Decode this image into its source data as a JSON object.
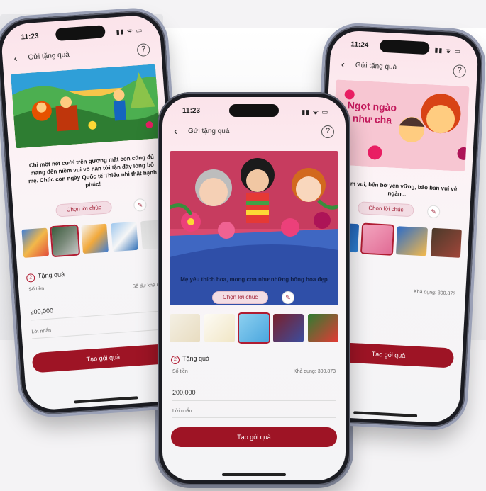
{
  "left_phone": {
    "time": "11:23",
    "status_icons": "▮▮ ᯤ ▭",
    "title": "Gửi tặng quà",
    "help": "?",
    "message": "Chỉ một nét cười trên gương mặt con cũng đủ mang đến niềm vui vô hạn tới tận đáy lòng bố mẹ. Chúc con ngày Quốc tế Thiếu nhi thật hạnh phúc!",
    "wish_button": "Chọn lời chúc",
    "section_num": "2",
    "section_label": "Tặng quà",
    "amount_label": "Số tiền",
    "balance": "Số dư khả dụng",
    "amount": "200,000",
    "note": "Lời nhắn",
    "cta": "Tạo gói quà"
  },
  "center_phone": {
    "time": "11:23",
    "status_icons": "▮▮ ᯤ ▭",
    "title": "Gửi tặng quà",
    "help": "?",
    "message": "Mẹ yêu thích hoa, mong con như những bông hoa đẹp",
    "wish_button": "Chọn lời chúc",
    "section_num": "2",
    "section_label": "Tặng quà",
    "amount_label": "Số tiền",
    "balance": "Khả dụng: 300,873",
    "amount": "200,000",
    "note": "Lời nhắn",
    "cta": "Tạo gói quà"
  },
  "right_phone": {
    "time": "11:24",
    "status_icons": "▮▮ ᯤ ▭",
    "title": "Gửi tặng quà",
    "help": "?",
    "art_text_1": "Ngọt ngào",
    "art_text_2": "như cha",
    "message": "...niềm vui, bến bờ yên vững, bảo ban vui vẻ ngàn...",
    "wish_button": "Chọn lời chúc",
    "balance": "Khả dụng: 300,873",
    "cta": "Tạo gói quà"
  },
  "colors": {
    "brand_red": "#9e1425",
    "accent_pink": "#f3dde4",
    "frame": "#1b1c22"
  }
}
